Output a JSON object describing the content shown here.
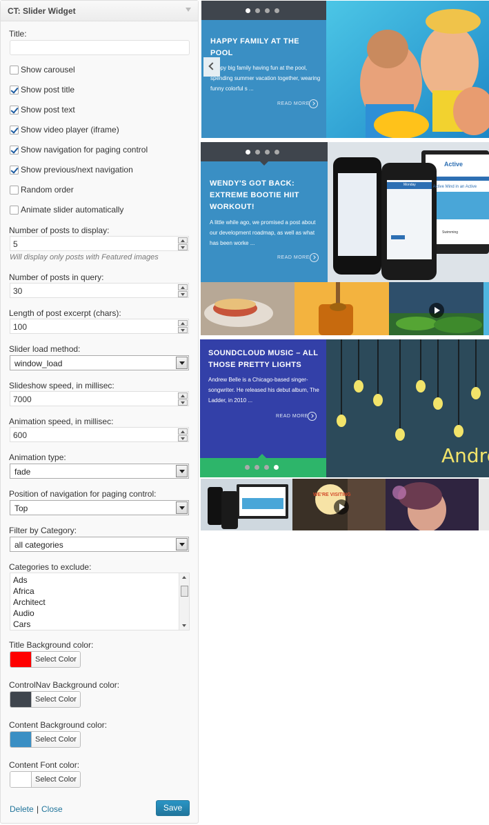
{
  "widget": {
    "title": "CT: Slider Widget",
    "title_label": "Title:",
    "title_value": "",
    "checkboxes": [
      {
        "label": "Show carousel",
        "checked": false
      },
      {
        "label": "Show post title",
        "checked": true
      },
      {
        "label": "Show post text",
        "checked": true
      },
      {
        "label": "Show video player (iframe)",
        "checked": true
      },
      {
        "label": "Show navigation for paging control",
        "checked": true
      },
      {
        "label": "Show previous/next navigation",
        "checked": true
      },
      {
        "label": "Random order",
        "checked": false
      },
      {
        "label": "Animate slider automatically",
        "checked": false
      }
    ],
    "posts_display_label": "Number of posts to display:",
    "posts_display_value": "5",
    "posts_display_hint": "Will display only posts with Featured images",
    "posts_query_label": "Number of posts in query:",
    "posts_query_value": "30",
    "excerpt_label": "Length of post excerpt (chars):",
    "excerpt_value": "100",
    "load_method_label": "Slider load method:",
    "load_method_value": "window_load",
    "slideshow_speed_label": "Slideshow speed, in millisec:",
    "slideshow_speed_value": "7000",
    "animation_speed_label": "Animation speed, in millisec:",
    "animation_speed_value": "600",
    "animation_type_label": "Animation type:",
    "animation_type_value": "fade",
    "nav_position_label": "Position of navigation for paging control:",
    "nav_position_value": "Top",
    "filter_category_label": "Filter by Category:",
    "filter_category_value": "all categories",
    "exclude_label": "Categories to exclude:",
    "exclude_options": [
      "Ads",
      "Africa",
      "Architect",
      "Audio",
      "Cars"
    ],
    "colors": [
      {
        "label": "Title Background color:",
        "button": "Select Color",
        "value": "#ff0000"
      },
      {
        "label": "ControlNav Background color:",
        "button": "Select Color",
        "value": "#3f454d"
      },
      {
        "label": "Content Background color:",
        "button": "Select Color",
        "value": "#3a8fc4"
      },
      {
        "label": "Content Font color:",
        "button": "Select Color",
        "value": "#ffffff"
      }
    ],
    "delete_label": "Delete",
    "separator": "|",
    "close_label": "Close",
    "save_label": "Save"
  },
  "preview": {
    "slides": [
      {
        "title": "HAPPY FAMILY AT THE POOL",
        "text": "Happy big family having fun at the pool, spending summer vacation together, wearing funny colorful s ...",
        "more": "READ MORE"
      },
      {
        "title": "WENDY'S GOT BACK: EXTREME BOOTIE HIIT WORKOUT!",
        "text": "A little while ago, we promised a post about our development roadmap, as well as what has been worke ...",
        "more": "READ MORE"
      },
      {
        "title": "SOUNDCLOUD MUSIC – ALL THOSE PRETTY LIGHTS",
        "text": "Andrew Belle is a Chicago-based singer-songwriter. He released his debut album, The Ladder, in 2010 ...",
        "more": "READ MORE"
      }
    ],
    "phone_header": "Monday",
    "site_brand": "Active",
    "site_headline": "An Active Mind in an Active",
    "site_caption": "Swimming",
    "andrew_text": "Andre",
    "visiting_text": "WE'RE VISITING"
  },
  "colors": {
    "content_blue": "#3a8fc4",
    "nav_dark": "#3f454d",
    "sound_blue": "#3340a8",
    "sound_green": "#2db56a",
    "link_blue": "#21759b"
  }
}
